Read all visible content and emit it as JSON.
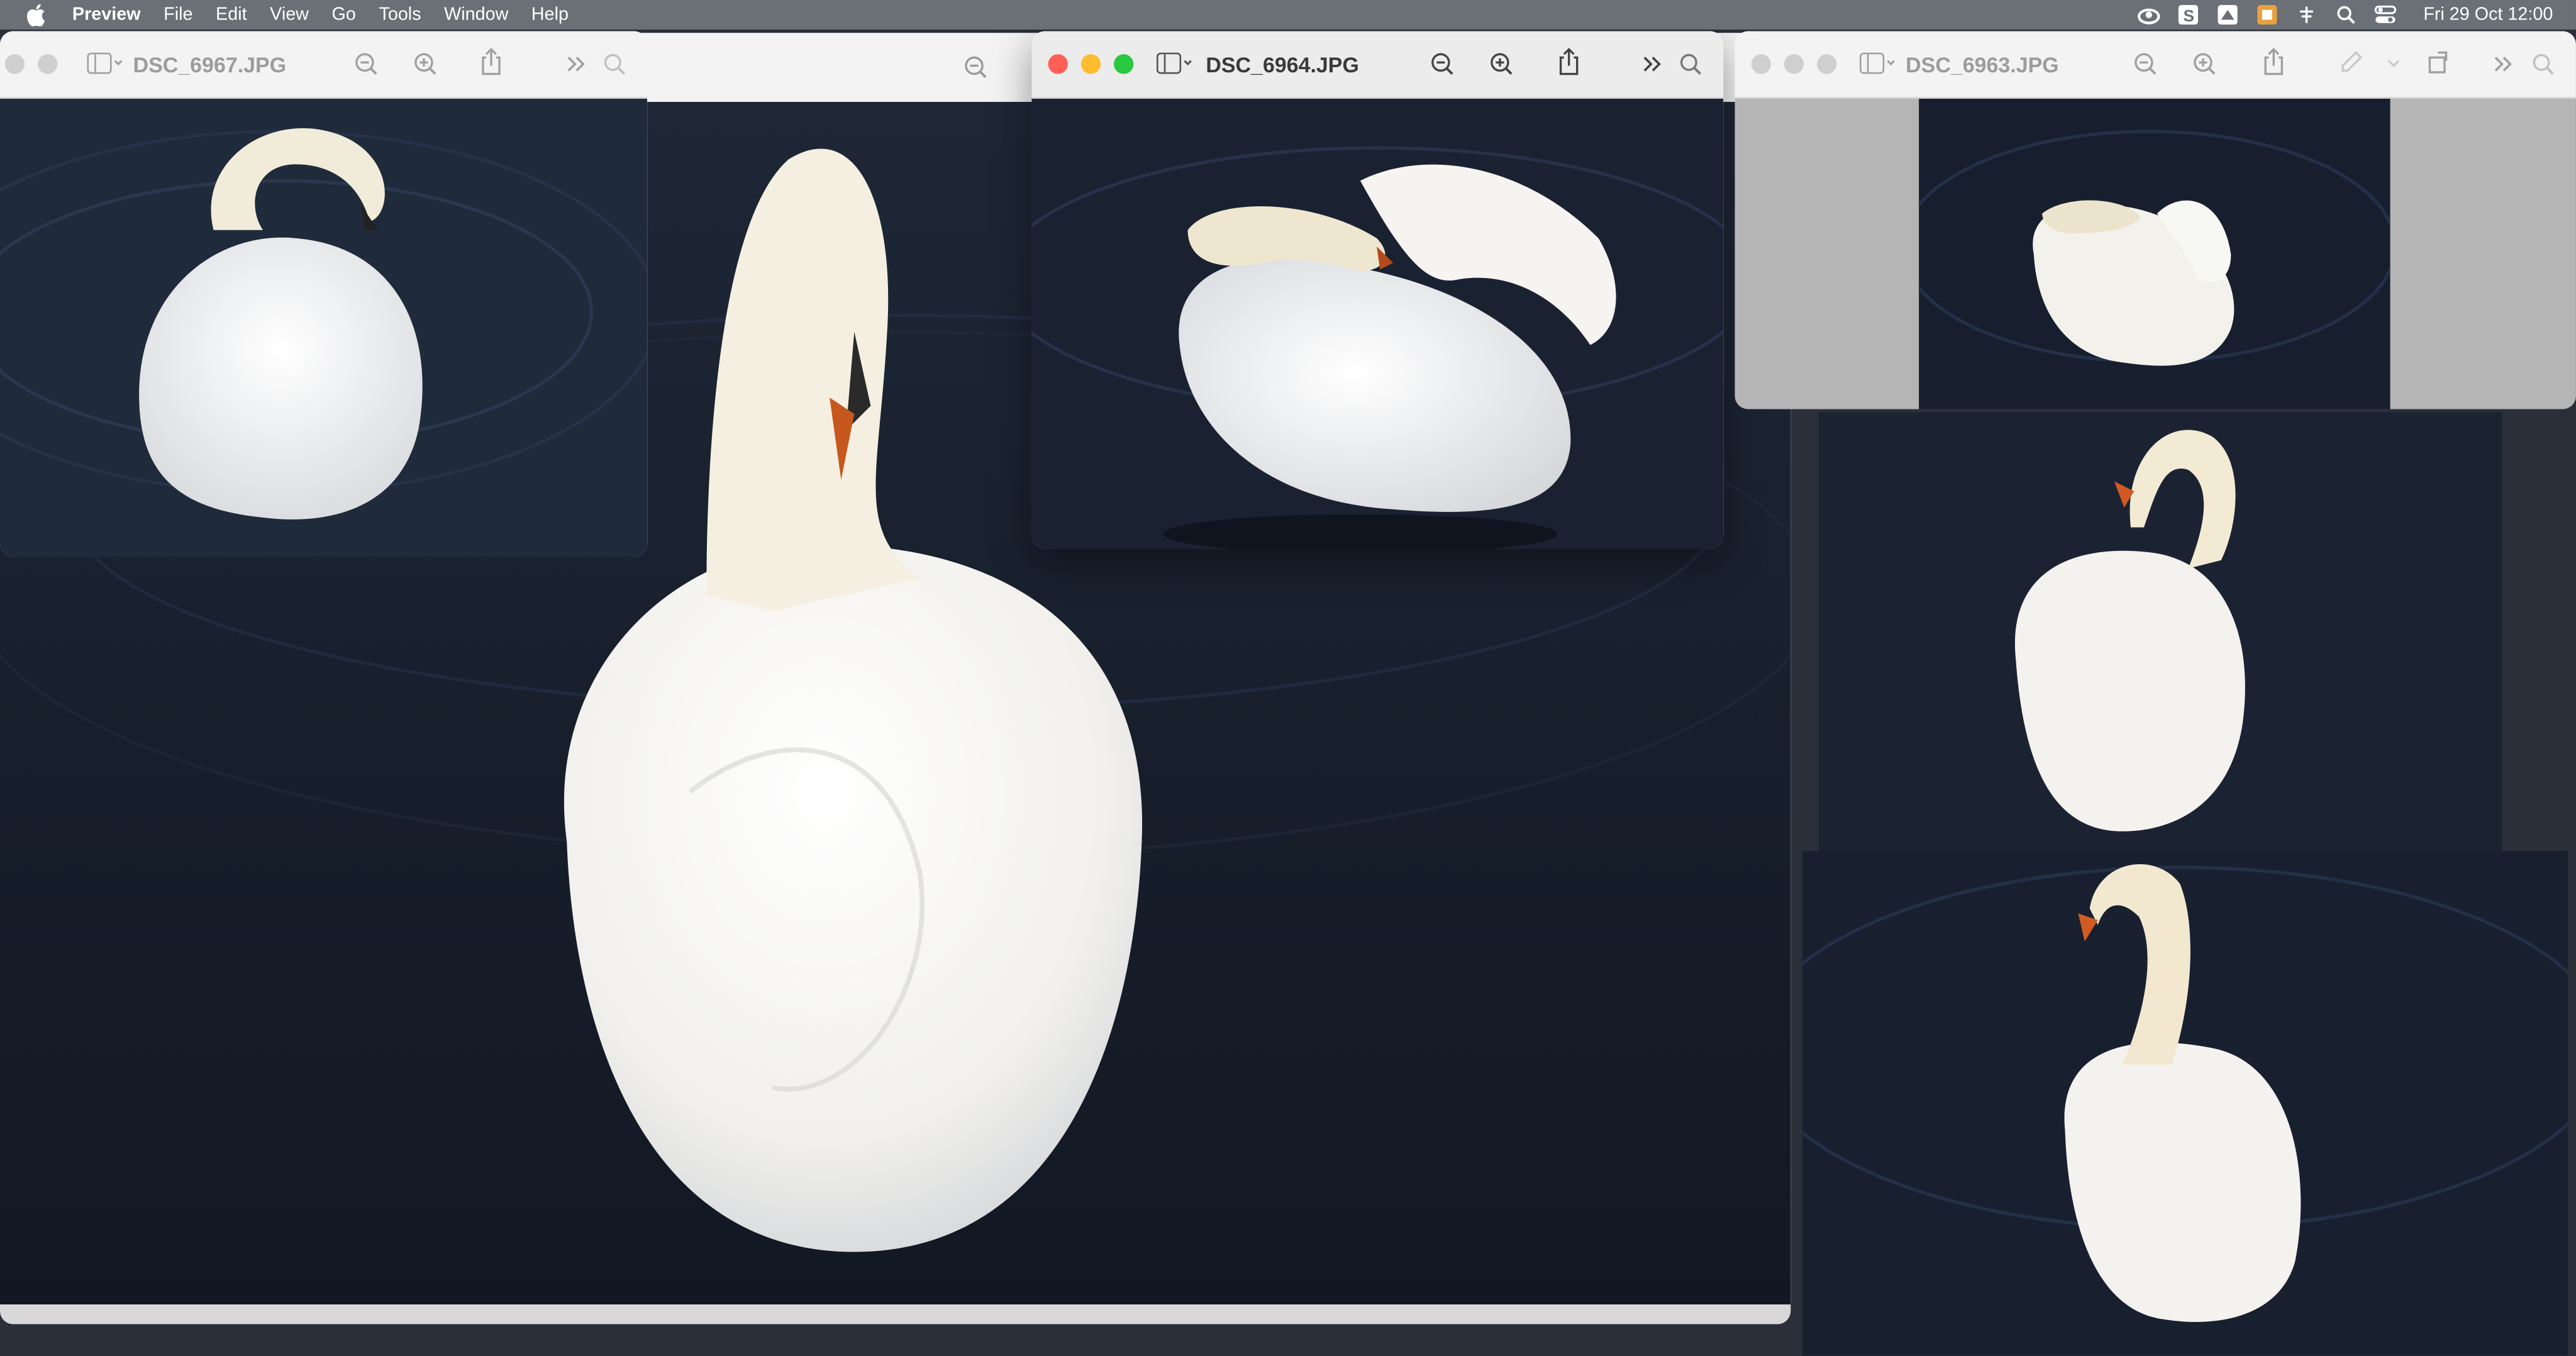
{
  "menubar": {
    "app_name": "Preview",
    "menus": [
      "File",
      "Edit",
      "View",
      "Go",
      "Tools",
      "Window",
      "Help"
    ],
    "clock": "Fri 29 Oct  12:00",
    "status_icons": [
      "creative-cloud-icon",
      "scrivener-icon",
      "app-icon",
      "app-icon-2",
      "network-icon",
      "search-icon",
      "control-center-icon"
    ]
  },
  "windows": [
    {
      "title": "DSC_6967.JPG",
      "state": "inactive"
    },
    {
      "title": "",
      "state": "inactive"
    },
    {
      "title": "DSC_6964.JPG",
      "state": "active"
    },
    {
      "title": "DSC_6963.JPG",
      "state": "inactive"
    }
  ],
  "colors": {
    "water": "#1a2230",
    "swan": "#f7f6f2",
    "close": "#ff5f57",
    "minimize": "#febc2e",
    "zoom": "#28c840"
  }
}
